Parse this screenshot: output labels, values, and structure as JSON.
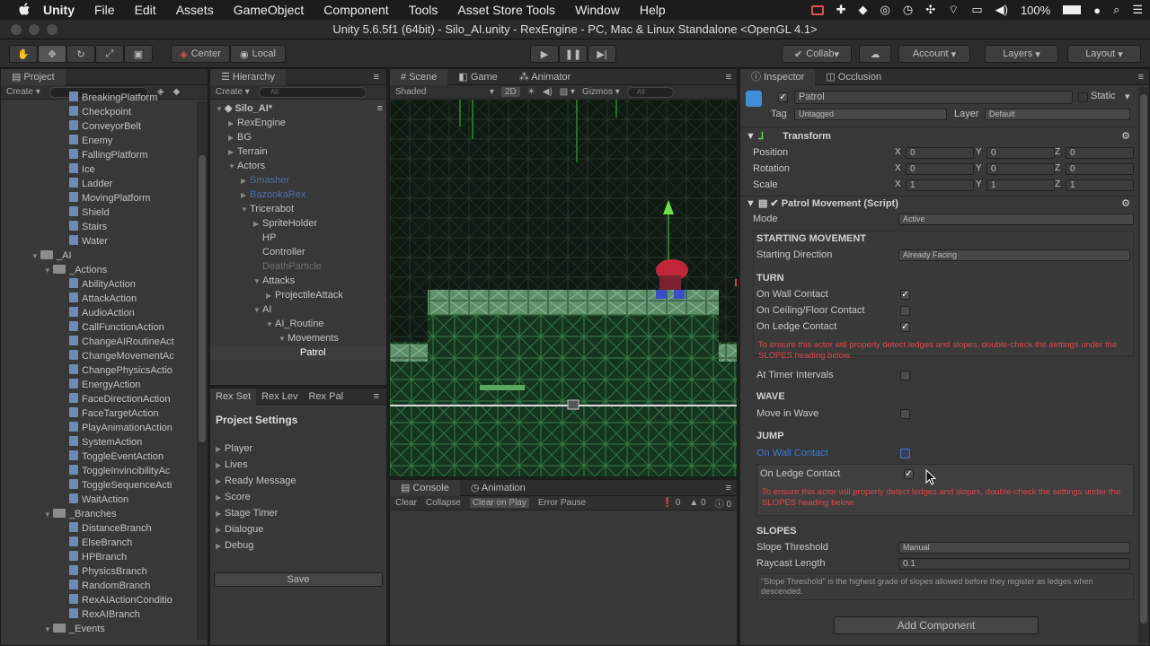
{
  "menubar": {
    "app": "Unity",
    "items": [
      "File",
      "Edit",
      "Assets",
      "GameObject",
      "Component",
      "Tools",
      "Asset Store Tools",
      "Window",
      "Help"
    ],
    "battery": "100%"
  },
  "window_title": "Unity 5.6.5f1 (64bit) - Silo_AI.unity - RexEngine - PC, Mac & Linux Standalone <OpenGL 4.1>",
  "toolbar": {
    "pivot_center": "Center",
    "pivot_local": "Local",
    "collab": "Collab",
    "account": "Account",
    "layers": "Layers",
    "layout": "Layout"
  },
  "project": {
    "tab": "Project",
    "create": "Create",
    "items": [
      {
        "label": "BreakingPlatform",
        "indent": 76,
        "kind": "file"
      },
      {
        "label": "Checkpoint",
        "indent": 76,
        "kind": "file"
      },
      {
        "label": "ConveyorBelt",
        "indent": 76,
        "kind": "file"
      },
      {
        "label": "Enemy",
        "indent": 76,
        "kind": "file"
      },
      {
        "label": "FallingPlatform",
        "indent": 76,
        "kind": "file"
      },
      {
        "label": "Ice",
        "indent": 76,
        "kind": "file"
      },
      {
        "label": "Ladder",
        "indent": 76,
        "kind": "file"
      },
      {
        "label": "MovingPlatform",
        "indent": 76,
        "kind": "file"
      },
      {
        "label": "Shield",
        "indent": 76,
        "kind": "file"
      },
      {
        "label": "Stairs",
        "indent": 76,
        "kind": "file"
      },
      {
        "label": "Water",
        "indent": 76,
        "kind": "file"
      },
      {
        "label": "_AI",
        "indent": 46,
        "kind": "folder"
      },
      {
        "label": "_Actions",
        "indent": 60,
        "kind": "folder"
      },
      {
        "label": "AbilityAction",
        "indent": 76,
        "kind": "file"
      },
      {
        "label": "AttackAction",
        "indent": 76,
        "kind": "file"
      },
      {
        "label": "AudioAction",
        "indent": 76,
        "kind": "file"
      },
      {
        "label": "CallFunctionAction",
        "indent": 76,
        "kind": "file"
      },
      {
        "label": "ChangeAIRoutineAct",
        "indent": 76,
        "kind": "file"
      },
      {
        "label": "ChangeMovementAc",
        "indent": 76,
        "kind": "file"
      },
      {
        "label": "ChangePhysicsActio",
        "indent": 76,
        "kind": "file"
      },
      {
        "label": "EnergyAction",
        "indent": 76,
        "kind": "file"
      },
      {
        "label": "FaceDirectionAction",
        "indent": 76,
        "kind": "file"
      },
      {
        "label": "FaceTargetAction",
        "indent": 76,
        "kind": "file"
      },
      {
        "label": "PlayAnimationAction",
        "indent": 76,
        "kind": "file"
      },
      {
        "label": "SystemAction",
        "indent": 76,
        "kind": "file"
      },
      {
        "label": "ToggleEventAction",
        "indent": 76,
        "kind": "file"
      },
      {
        "label": "ToggleInvincibilityAc",
        "indent": 76,
        "kind": "file"
      },
      {
        "label": "ToggleSequenceActi",
        "indent": 76,
        "kind": "file"
      },
      {
        "label": "WaitAction",
        "indent": 76,
        "kind": "file"
      },
      {
        "label": "_Branches",
        "indent": 60,
        "kind": "folder"
      },
      {
        "label": "DistanceBranch",
        "indent": 76,
        "kind": "file"
      },
      {
        "label": "ElseBranch",
        "indent": 76,
        "kind": "file"
      },
      {
        "label": "HPBranch",
        "indent": 76,
        "kind": "file"
      },
      {
        "label": "PhysicsBranch",
        "indent": 76,
        "kind": "file"
      },
      {
        "label": "RandomBranch",
        "indent": 76,
        "kind": "file"
      },
      {
        "label": "RexAIActionConditio",
        "indent": 76,
        "kind": "file"
      },
      {
        "label": "RexAIBranch",
        "indent": 76,
        "kind": "file"
      },
      {
        "label": "_Events",
        "indent": 60,
        "kind": "folder"
      }
    ]
  },
  "hierarchy": {
    "tab": "Hierarchy",
    "create": "Create",
    "search_placeholder": "All",
    "scene": "Silo_AI*",
    "items": [
      {
        "label": "RexEngine",
        "indent": 14,
        "arrow": "▶",
        "style": ""
      },
      {
        "label": "BG",
        "indent": 14,
        "arrow": "▶",
        "style": ""
      },
      {
        "label": "Terrain",
        "indent": 14,
        "arrow": "▶",
        "style": ""
      },
      {
        "label": "Actors",
        "indent": 14,
        "arrow": "▼",
        "style": ""
      },
      {
        "label": "Smasher",
        "indent": 28,
        "arrow": "▶",
        "style": "prefab"
      },
      {
        "label": "BazookaRex",
        "indent": 28,
        "arrow": "▶",
        "style": "prefab"
      },
      {
        "label": "Tricerabot",
        "indent": 28,
        "arrow": "▼",
        "style": ""
      },
      {
        "label": "SpriteHolder",
        "indent": 42,
        "arrow": "▶",
        "style": ""
      },
      {
        "label": "HP",
        "indent": 42,
        "arrow": "",
        "style": ""
      },
      {
        "label": "Controller",
        "indent": 42,
        "arrow": "",
        "style": ""
      },
      {
        "label": "DeathParticle",
        "indent": 42,
        "arrow": "",
        "style": "disabled"
      },
      {
        "label": "Attacks",
        "indent": 42,
        "arrow": "▼",
        "style": ""
      },
      {
        "label": "ProjectileAttack",
        "indent": 56,
        "arrow": "▶",
        "style": ""
      },
      {
        "label": "AI",
        "indent": 42,
        "arrow": "▼",
        "style": ""
      },
      {
        "label": "AI_Routine",
        "indent": 56,
        "arrow": "▼",
        "style": ""
      },
      {
        "label": "Movements",
        "indent": 70,
        "arrow": "▼",
        "style": ""
      },
      {
        "label": "Patrol",
        "indent": 84,
        "arrow": "",
        "style": "sel"
      }
    ]
  },
  "rexset": {
    "tabs": [
      "Rex Set",
      "Rex Lev",
      "Rex Pal"
    ],
    "heading": "Project Settings",
    "items": [
      "Player",
      "Lives",
      "Ready Message",
      "Score",
      "Stage Timer",
      "Dialogue",
      "Debug"
    ],
    "save": "Save"
  },
  "scene": {
    "tabs": [
      "Scene",
      "Game",
      "Animator"
    ],
    "shading": "Shaded",
    "mode_2d": "2D",
    "gizmos": "Gizmos",
    "search_placeholder": "All"
  },
  "console": {
    "tabs": [
      "Console",
      "Animation"
    ],
    "buttons": [
      "Clear",
      "Collapse",
      "Clear on Play",
      "Error Pause"
    ],
    "counts": [
      "0",
      "0",
      "0"
    ]
  },
  "inspector": {
    "tabs": [
      "Inspector",
      "Occlusion"
    ],
    "object_name": "Patrol",
    "static_label": "Static",
    "tag_label": "Tag",
    "tag_value": "Untagged",
    "layer_label": "Layer",
    "layer_value": "Default",
    "transform": {
      "title": "Transform",
      "rows": [
        {
          "label": "Position",
          "x": "0",
          "y": "0",
          "z": "0"
        },
        {
          "label": "Rotation",
          "x": "0",
          "y": "0",
          "z": "0"
        },
        {
          "label": "Scale",
          "x": "1",
          "y": "1",
          "z": "1"
        }
      ]
    },
    "script": {
      "title": "Patrol Movement (Script)",
      "mode_label": "Mode",
      "mode_value": "Active",
      "starting_header": "STARTING MOVEMENT",
      "starting_dir_label": "Starting Direction",
      "starting_dir_value": "Already Facing",
      "turn_header": "TURN",
      "on_wall": "On Wall Contact",
      "on_ceiling": "On Ceiling/Floor Contact",
      "on_ledge": "On Ledge Contact",
      "warning": "To ensure this actor will properly detect ledges and slopes, double-check the settings under the SLOPES heading below.",
      "at_timer": "At Timer Intervals",
      "wave_header": "WAVE",
      "move_wave": "Move in Wave",
      "jump_header": "JUMP",
      "jump_wall": "On Wall Contact",
      "jump_ledge": "On Ledge Contact",
      "slopes_header": "SLOPES",
      "slope_threshold_label": "Slope Threshold",
      "slope_threshold_value": "Manual",
      "raycast_label": "Raycast Length",
      "raycast_value": "0.1",
      "slope_note": "\"Slope Threshold\" is the highest grade of slopes allowed before they register as ledges when descended."
    },
    "add_component": "Add Component"
  },
  "colors": {
    "accent": "#3e7ad6",
    "warning": "#e0464b",
    "panel": "#383838"
  }
}
